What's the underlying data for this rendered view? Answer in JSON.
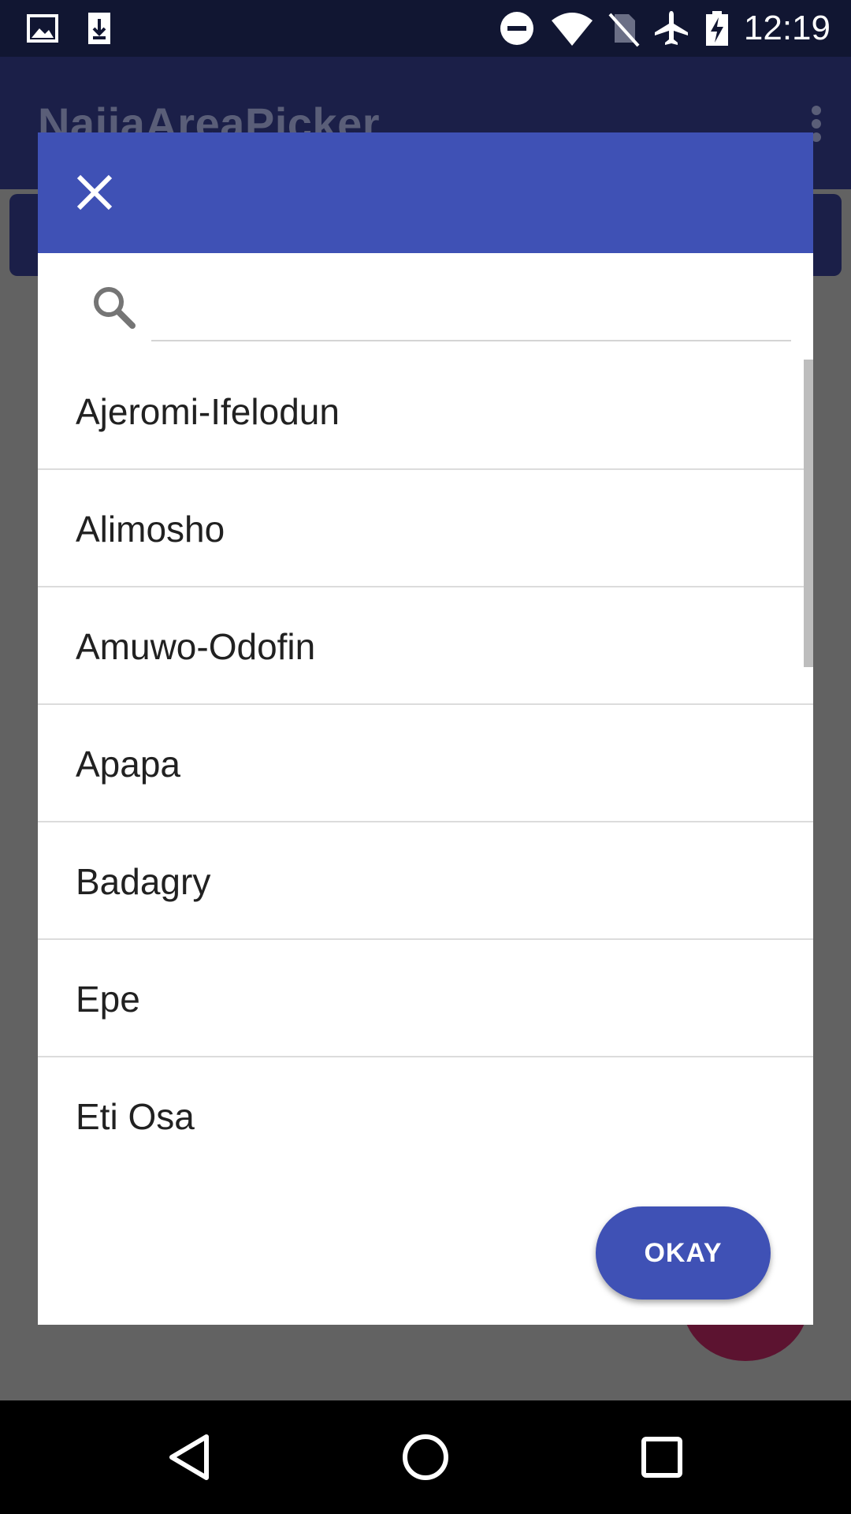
{
  "status_bar": {
    "time": "12:19",
    "icons": [
      "image-icon",
      "download-icon",
      "do-not-disturb-icon",
      "wifi-icon",
      "no-sim-icon",
      "airplane-mode-icon",
      "battery-charging-icon"
    ]
  },
  "app_bar": {
    "title": "NaijaAreaPicker",
    "overflow_icon": "more-vert-icon"
  },
  "dialog": {
    "header_color": "#3f51b5",
    "close_icon": "close-icon",
    "search": {
      "icon": "search-icon",
      "value": "",
      "placeholder": ""
    },
    "items": [
      {
        "label": "Ajeromi-Ifelodun"
      },
      {
        "label": "Alimosho"
      },
      {
        "label": "Amuwo-Odofin"
      },
      {
        "label": "Apapa"
      },
      {
        "label": "Badagry"
      },
      {
        "label": "Epe"
      },
      {
        "label": "Eti Osa"
      }
    ],
    "okay_label": "OKAY"
  },
  "nav_bar": {
    "icons": [
      "back-icon",
      "home-icon",
      "recents-icon"
    ]
  },
  "colors": {
    "accent": "#3f51b5",
    "status_bar": "#111632",
    "scrim": "#626262"
  }
}
